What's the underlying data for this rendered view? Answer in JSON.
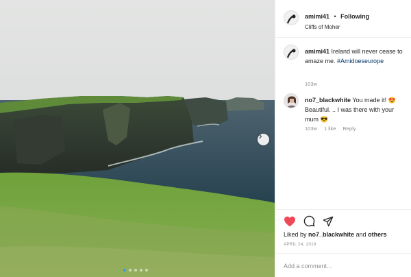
{
  "header": {
    "username": "amimi41",
    "bullet": "•",
    "follow_status": "Following",
    "location": "Cliffs of Moher"
  },
  "caption": {
    "username": "amimi41",
    "text": " Ireland will never cease to amaze me. ",
    "hashtag": "#Amidoeseurope",
    "time": "103w"
  },
  "comment": {
    "username": "no7_blackwhite",
    "text": " You made it! 😍 Beautiful. .. I was there with your mum 😎",
    "time": "103w",
    "likes": "1 like",
    "reply": "Reply"
  },
  "actions": {
    "liked_prefix": "Liked by ",
    "liked_user": "no7_blackwhite",
    "liked_mid": " and ",
    "liked_others": "others",
    "date": "APRIL 24, 2018",
    "comment_placeholder": "Add a comment..."
  },
  "colors": {
    "heart": "#ed4956",
    "hashtag": "#003569",
    "meta": "#8e8e8e"
  },
  "icons": [
    "heart-icon",
    "comment-icon",
    "share-icon",
    "chevron-right-icon"
  ]
}
